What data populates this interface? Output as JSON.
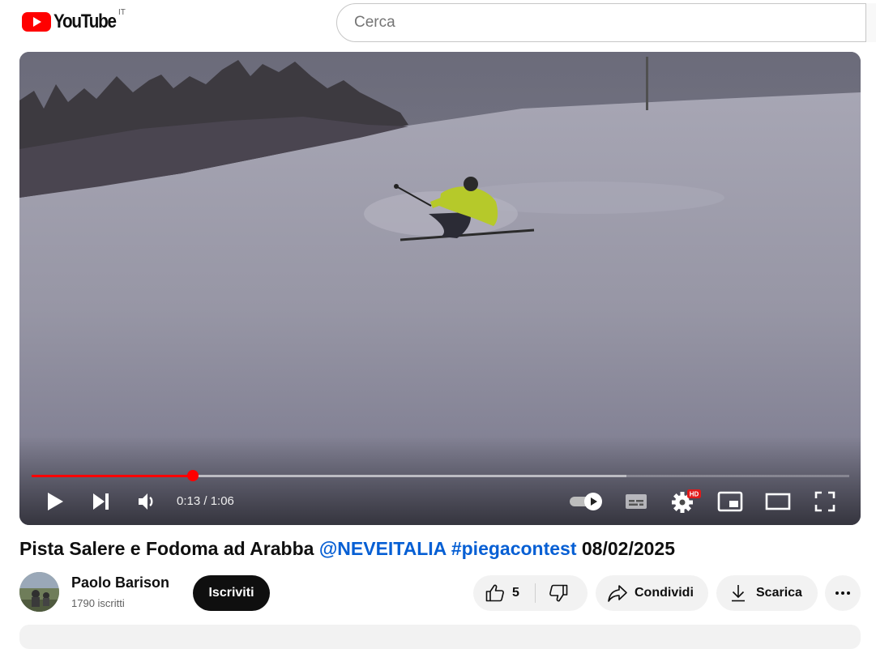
{
  "header": {
    "brand": "YouTube",
    "country": "IT",
    "search_placeholder": "Cerca"
  },
  "player": {
    "current_time": "0:13",
    "duration": "1:06",
    "time_display": "0:13 / 1:06",
    "progress_fraction": 0.197,
    "buffer_fraction": 0.727,
    "quality_badge": "HD",
    "autoplay_on": true
  },
  "video": {
    "title_part1": "Pista Salere e Fodoma ad Arabba ",
    "title_mention": "@NEVEITALIA",
    "title_hashtag": " #piegacontest",
    "title_date": " 08/02/2025"
  },
  "channel": {
    "name": "Paolo Barison",
    "subscribers": "1790 iscritti"
  },
  "actions": {
    "subscribe": "Iscriviti",
    "like_count": "5",
    "share": "Condividi",
    "download": "Scarica"
  },
  "icons": {
    "logo": "youtube-logo-icon",
    "play": "play-icon",
    "next": "next-icon",
    "volume": "volume-icon",
    "autoplay": "autoplay-toggle-icon",
    "subtitles": "subtitles-icon",
    "settings": "gear-icon",
    "miniplayer": "miniplayer-icon",
    "theater": "theater-mode-icon",
    "fullscreen": "fullscreen-icon",
    "like": "thumbs-up-icon",
    "dislike": "thumbs-down-icon",
    "share": "share-icon",
    "download": "download-icon",
    "more": "more-horizontal-icon"
  },
  "colors": {
    "brand_red": "#ff0000",
    "link_blue": "#065fd4",
    "pill_bg": "#f2f2f2",
    "subscribe_bg": "#0f0f0f"
  }
}
